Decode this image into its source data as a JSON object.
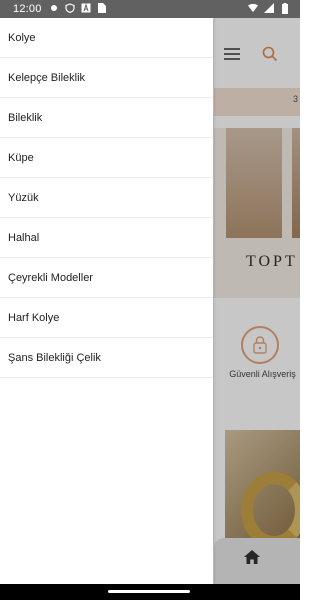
{
  "status_bar": {
    "time": "12:00",
    "left_icons": [
      "notification-dot-icon",
      "shield-icon",
      "a-icon",
      "sim-icon"
    ],
    "right_icons": [
      "wifi-icon",
      "signal-icon",
      "battery-icon"
    ]
  },
  "drawer": {
    "items": [
      {
        "label": "Kolye"
      },
      {
        "label": "Kelepçe Bileklik"
      },
      {
        "label": "Bileklik"
      },
      {
        "label": "Küpe"
      },
      {
        "label": "Yüzük"
      },
      {
        "label": "Halhal"
      },
      {
        "label": "Çeyrekli Modeller"
      },
      {
        "label": "Harf Kolye"
      },
      {
        "label": "Şans Bilekliği Çelik"
      }
    ]
  },
  "background": {
    "banner_text": "TOPT",
    "promo_mark": "3",
    "security_label": "Güvenli Alışveriş"
  },
  "colors": {
    "status_bar": "#616161",
    "accent": "#e3a57d"
  }
}
